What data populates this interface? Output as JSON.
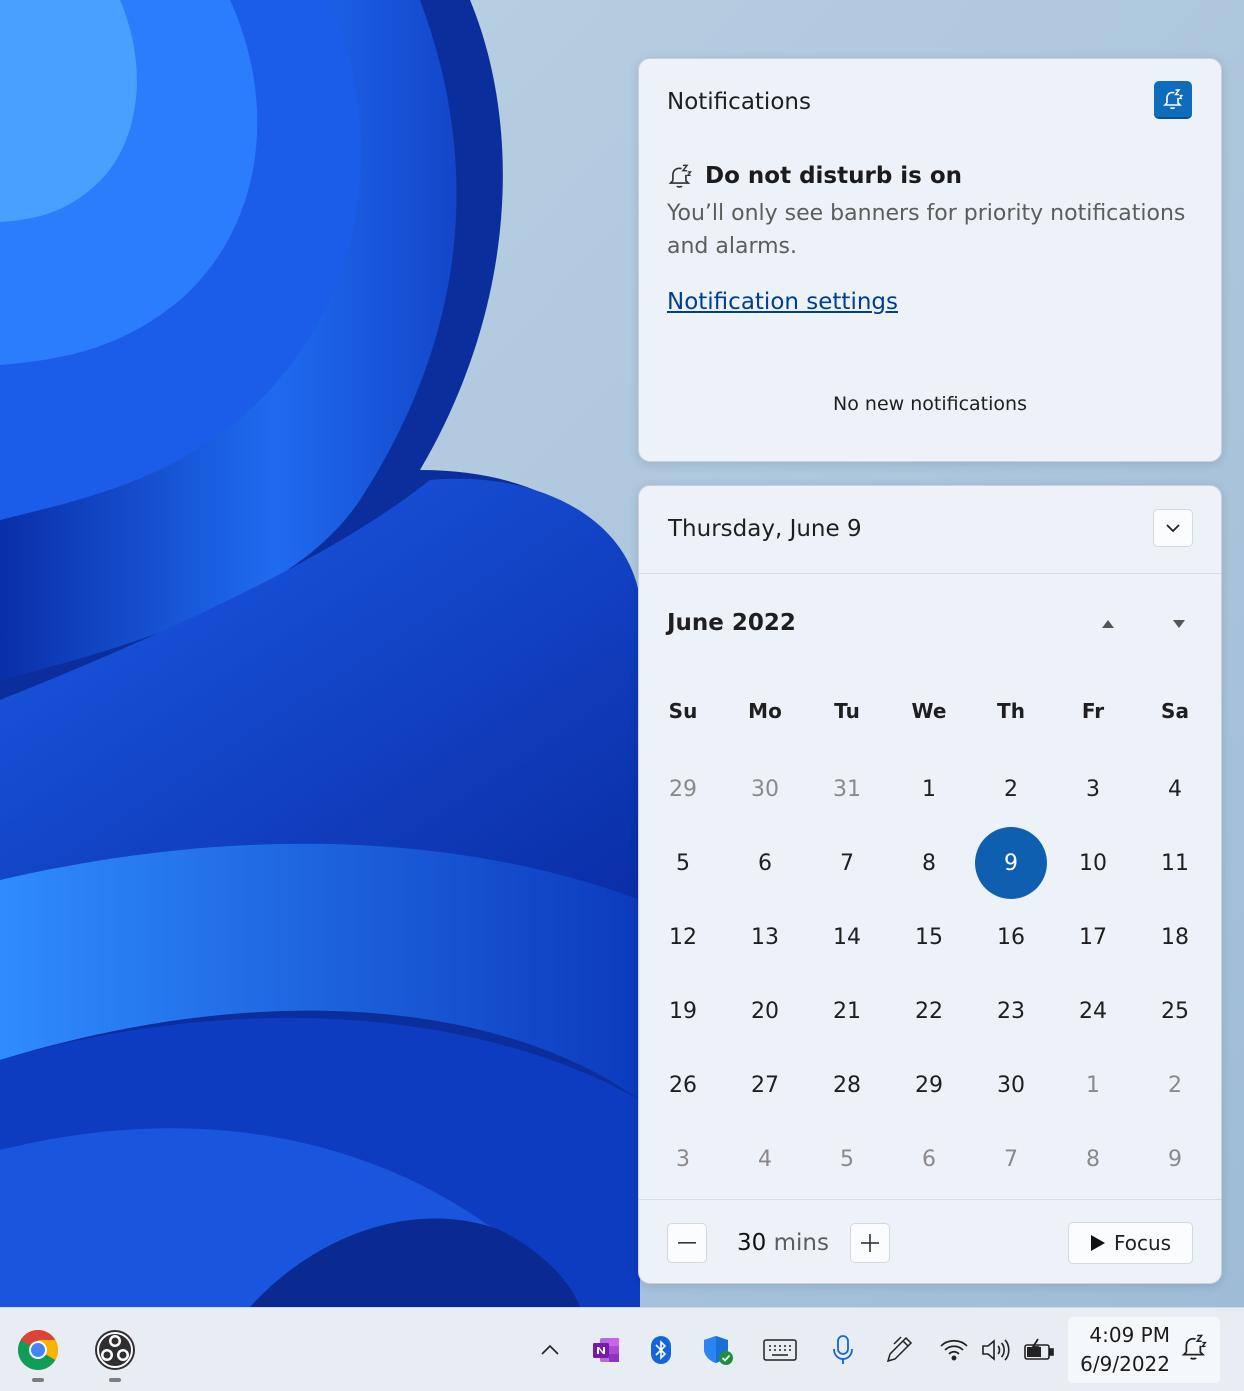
{
  "notifications": {
    "title": "Notifications",
    "dnd_heading": "Do not disturb is on",
    "dnd_body": "You’ll only see banners for priority notifications and alarms.",
    "settings_link": "Notification settings",
    "empty_message": "No new notifications"
  },
  "calendar": {
    "selected_date": "Thursday, June 9",
    "month_title": "June 2022",
    "weekdays": [
      "Su",
      "Mo",
      "Tu",
      "We",
      "Th",
      "Fr",
      "Sa"
    ],
    "days": [
      {
        "label": "29",
        "muted": true
      },
      {
        "label": "30",
        "muted": true
      },
      {
        "label": "31",
        "muted": true
      },
      {
        "label": "1"
      },
      {
        "label": "2"
      },
      {
        "label": "3"
      },
      {
        "label": "4"
      },
      {
        "label": "5"
      },
      {
        "label": "6"
      },
      {
        "label": "7"
      },
      {
        "label": "8"
      },
      {
        "label": "9",
        "today": true
      },
      {
        "label": "10"
      },
      {
        "label": "11"
      },
      {
        "label": "12"
      },
      {
        "label": "13"
      },
      {
        "label": "14"
      },
      {
        "label": "15"
      },
      {
        "label": "16"
      },
      {
        "label": "17"
      },
      {
        "label": "18"
      },
      {
        "label": "19"
      },
      {
        "label": "20"
      },
      {
        "label": "21"
      },
      {
        "label": "22"
      },
      {
        "label": "23"
      },
      {
        "label": "24"
      },
      {
        "label": "25"
      },
      {
        "label": "26"
      },
      {
        "label": "27"
      },
      {
        "label": "28"
      },
      {
        "label": "29"
      },
      {
        "label": "30"
      },
      {
        "label": "1",
        "muted": true
      },
      {
        "label": "2",
        "muted": true
      },
      {
        "label": "3",
        "muted": true
      },
      {
        "label": "4",
        "muted": true
      },
      {
        "label": "5",
        "muted": true
      },
      {
        "label": "6",
        "muted": true
      },
      {
        "label": "7",
        "muted": true
      },
      {
        "label": "8",
        "muted": true
      },
      {
        "label": "9",
        "muted": true
      }
    ]
  },
  "focus": {
    "duration_value": "30",
    "duration_unit": "mins",
    "button_label": "Focus"
  },
  "taskbar": {
    "apps": [
      "chrome-icon",
      "obs-studio-icon"
    ],
    "tray_icons": [
      "chevron-up-icon",
      "onenote-icon",
      "bluetooth-icon",
      "windows-security-icon",
      "touch-keyboard-icon",
      "microphone-icon",
      "pen-icon",
      "wifi-icon",
      "volume-icon",
      "battery-charging-icon"
    ],
    "time": "4:09 PM",
    "date": "6/9/2022"
  },
  "colors": {
    "accent": "#0f6cbd",
    "today_circle": "#0f5fb0",
    "link": "#003e92"
  }
}
